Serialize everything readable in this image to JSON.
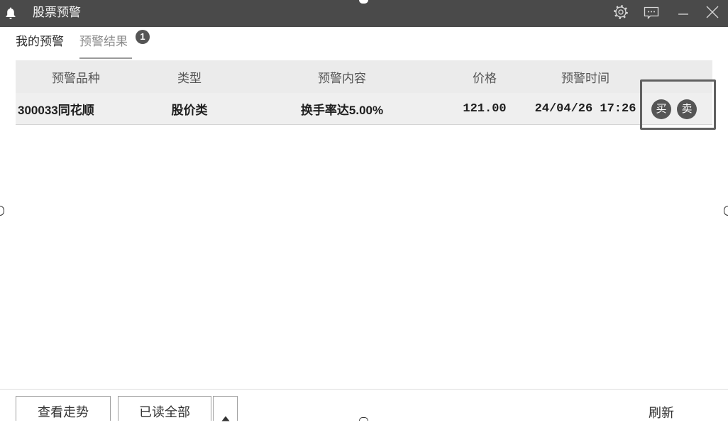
{
  "window": {
    "title": "股票预警"
  },
  "title_bar": {
    "icons": [
      "bell-icon",
      "gear-icon",
      "message-icon",
      "minimize-icon",
      "close-icon"
    ]
  },
  "tabs": [
    {
      "label": "我的预警"
    },
    {
      "label": "预警结果",
      "badge": "1"
    }
  ],
  "table": {
    "columns": [
      "预警品种",
      "类型",
      "预警内容",
      "价格",
      "预警时间"
    ],
    "rows": [
      {
        "symbol": "300033同花顺",
        "type": "股价类",
        "content": "换手率达5.00%",
        "price": "121.00",
        "time": "24/04/26 17:26",
        "buy": "买",
        "sell": "卖"
      }
    ]
  },
  "footer": {
    "view_trend": "查看走势",
    "mark_all_read": "已读全部",
    "refresh": "刷新",
    "expand_icon": "caret-up-icon"
  },
  "colors": {
    "title_bar": "#4a4a4a",
    "badge": "#555555",
    "action_button": "#555555",
    "highlight_border": "#606060"
  }
}
